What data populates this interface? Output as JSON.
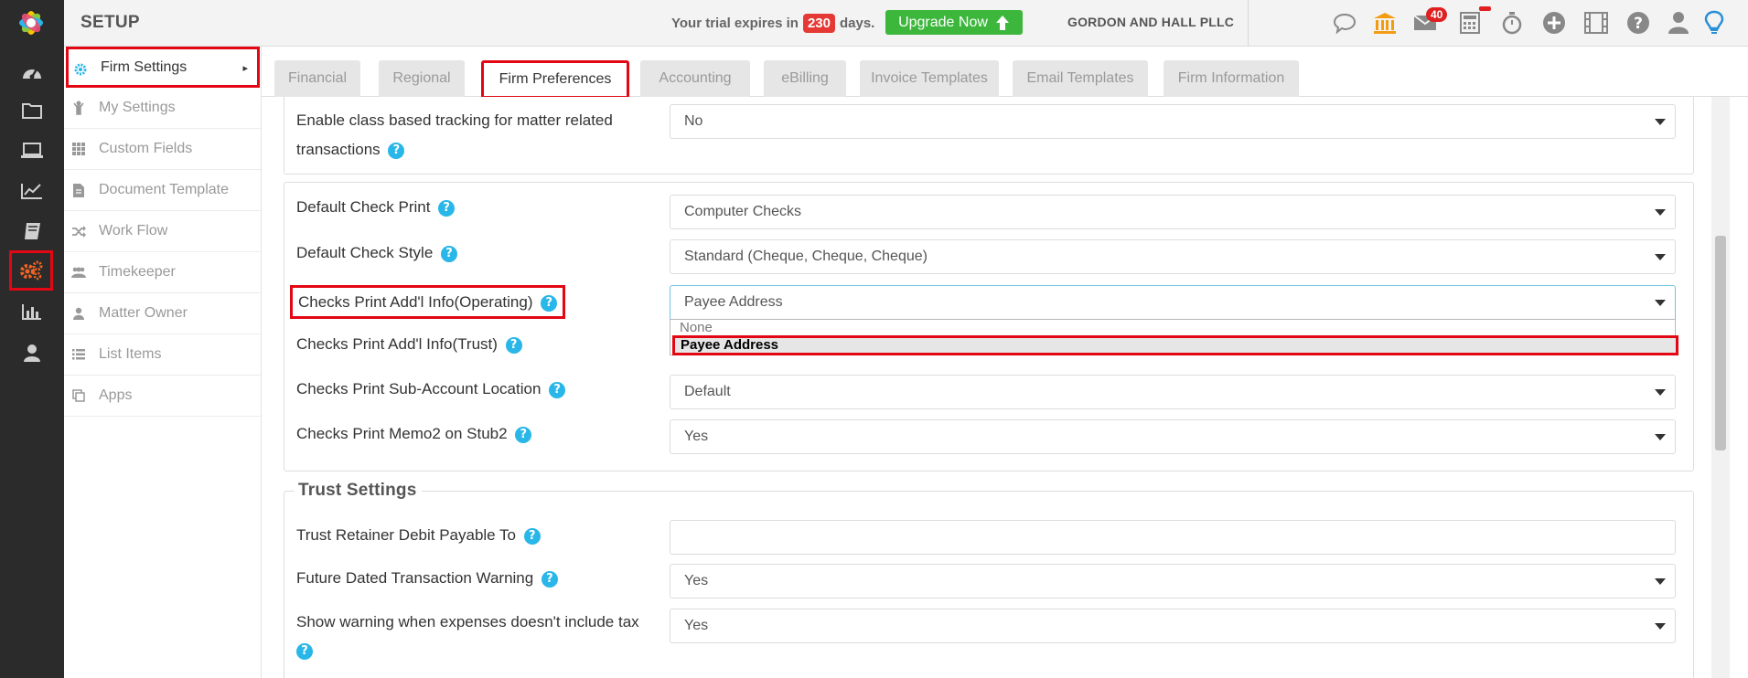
{
  "app": {
    "section_title": "SETUP"
  },
  "topbar": {
    "trial_prefix": "Your trial expires in",
    "trial_days": "230",
    "trial_suffix": "days.",
    "upgrade_label": "Upgrade Now",
    "firm_name": "GORDON AND HALL PLLC",
    "mail_count": "40",
    "icons": [
      "chat-icon",
      "bank-icon",
      "mail-icon",
      "calculator-icon",
      "stopwatch-icon",
      "add-circle-icon",
      "film-icon",
      "help-icon",
      "user-icon",
      "lightbulb-icon"
    ]
  },
  "rail": {
    "items": [
      "dashboard-icon",
      "folder-icon",
      "laptop-icon",
      "chart-icon",
      "book-icon",
      "settings-gears-icon",
      "bar-chart-icon",
      "user-icon"
    ],
    "active": "settings-gears-icon"
  },
  "setnav": {
    "items": [
      {
        "label": "Firm Settings",
        "icon": "gear-icon",
        "active": true
      },
      {
        "label": "My Settings",
        "icon": "person-wave-icon"
      },
      {
        "label": "Custom Fields",
        "icon": "grid-icon"
      },
      {
        "label": "Document Template",
        "icon": "document-icon"
      },
      {
        "label": "Work Flow",
        "icon": "shuffle-icon"
      },
      {
        "label": "Timekeeper",
        "icon": "people-icon"
      },
      {
        "label": "Matter Owner",
        "icon": "person-icon"
      },
      {
        "label": "List Items",
        "icon": "list-icon"
      },
      {
        "label": "Apps",
        "icon": "copy-icon"
      }
    ]
  },
  "tabs": [
    "Financial",
    "Regional",
    "Firm Preferences",
    "Accounting",
    "eBilling",
    "Invoice Templates",
    "Email Templates",
    "Firm Information"
  ],
  "active_tab": "Firm Preferences",
  "prefs": {
    "class_tracking": {
      "label_line1": "Enable class based tracking for matter related",
      "label_line2": "transactions",
      "value": "No"
    },
    "default_check_print": {
      "label": "Default Check Print",
      "value": "Computer Checks"
    },
    "default_check_style": {
      "label": "Default Check Style",
      "value": "Standard (Cheque, Cheque, Cheque)"
    },
    "addl_info_operating": {
      "label": "Checks Print Add'l Info(Operating)",
      "value": "Payee Address",
      "options": [
        "None",
        "Payee Address"
      ],
      "selected": "Payee Address"
    },
    "addl_info_trust": {
      "label": "Checks Print Add'l Info(Trust)"
    },
    "sub_account_location": {
      "label": "Checks Print Sub-Account Location",
      "value": "Default"
    },
    "memo2_stub2": {
      "label": "Checks Print Memo2 on Stub2",
      "value": "Yes"
    }
  },
  "trust": {
    "legend": "Trust Settings",
    "retainer_payable": {
      "label": "Trust Retainer Debit Payable To",
      "value": ""
    },
    "future_dated_warning": {
      "label": "Future Dated Transaction Warning",
      "value": "Yes"
    },
    "expense_tax_warning": {
      "label": "Show warning when expenses doesn't include tax",
      "value": "Yes"
    }
  },
  "colors": {
    "accent_red": "#e30613",
    "brand_green": "#3cb73c",
    "help_blue": "#29b6e8",
    "rail_dark": "#2b2b2b"
  }
}
